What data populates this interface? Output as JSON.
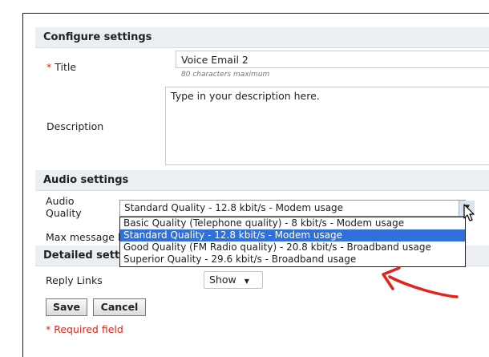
{
  "configure": {
    "header": "Configure settings",
    "title_required_mark": "*",
    "title_label": "Title",
    "title_value": "Voice Email 2",
    "title_hint": "80 characters maximum",
    "description_label": "Description",
    "description_placeholder": "Type in your description here."
  },
  "audio": {
    "header": "Audio settings",
    "quality_label_line1": "Audio",
    "quality_label_line2": "Quality",
    "selected_value": "Standard Quality - 12.8 kbit/s - Modem usage",
    "options": [
      "Basic Quality (Telephone quality) - 8 kbit/s - Modem usage",
      "Standard Quality - 12.8 kbit/s - Modem usage",
      "Good Quality (FM Radio quality) - 20.8 kbit/s - Broadband usage",
      "Superior Quality - 29.6 kbit/s - Broadband usage"
    ],
    "max_message_label": "Max message l"
  },
  "detailed": {
    "header": "Detailed setti",
    "reply_links_label": "Reply Links",
    "reply_links_value": "Show"
  },
  "actions": {
    "save_label": "Save",
    "cancel_label": "Cancel",
    "required_mark": "*",
    "required_text": "Required field"
  },
  "colors": {
    "section_header_bg": "#ebeef3",
    "selected_option_bg": "#3070d8",
    "required_red": "#d8271a",
    "annotation_arrow": "#e0231b"
  }
}
